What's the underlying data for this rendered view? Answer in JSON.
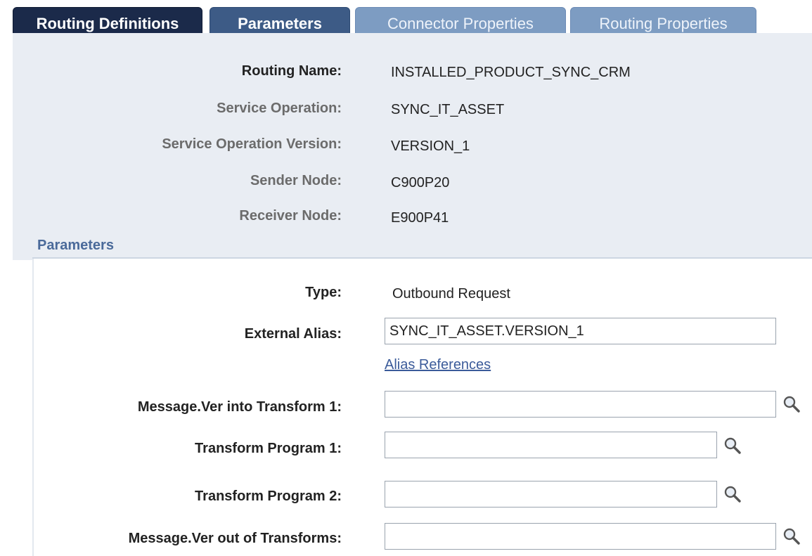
{
  "tabs": [
    {
      "label": "Routing Definitions"
    },
    {
      "label": "Parameters"
    },
    {
      "label": "Connector Properties"
    },
    {
      "label": "Routing Properties"
    }
  ],
  "header": {
    "routing_name_label": "Routing Name:",
    "routing_name_value": "INSTALLED_PRODUCT_SYNC_CRM",
    "service_operation_label": "Service Operation:",
    "service_operation_value": "SYNC_IT_ASSET",
    "service_operation_version_label": "Service Operation Version:",
    "service_operation_version_value": "VERSION_1",
    "sender_node_label": "Sender Node:",
    "sender_node_value": "C900P20",
    "receiver_node_label": "Receiver Node:",
    "receiver_node_value": "E900P41"
  },
  "parameters": {
    "section_title": "Parameters",
    "type_label": "Type:",
    "type_value": "Outbound Request",
    "external_alias_label": "External Alias:",
    "external_alias_value": "SYNC_IT_ASSET.VERSION_1",
    "alias_references_link": "Alias References",
    "msg_into_transform_label": "Message.Ver into Transform 1:",
    "msg_into_transform_value": "",
    "transform_program_1_label": "Transform Program 1:",
    "transform_program_1_value": "",
    "transform_program_2_label": "Transform Program 2:",
    "transform_program_2_value": "",
    "msg_out_of_transforms_label": "Message.Ver out of Transforms:",
    "msg_out_of_transforms_value": ""
  },
  "icons": {
    "lookup": "magnifier-icon"
  }
}
